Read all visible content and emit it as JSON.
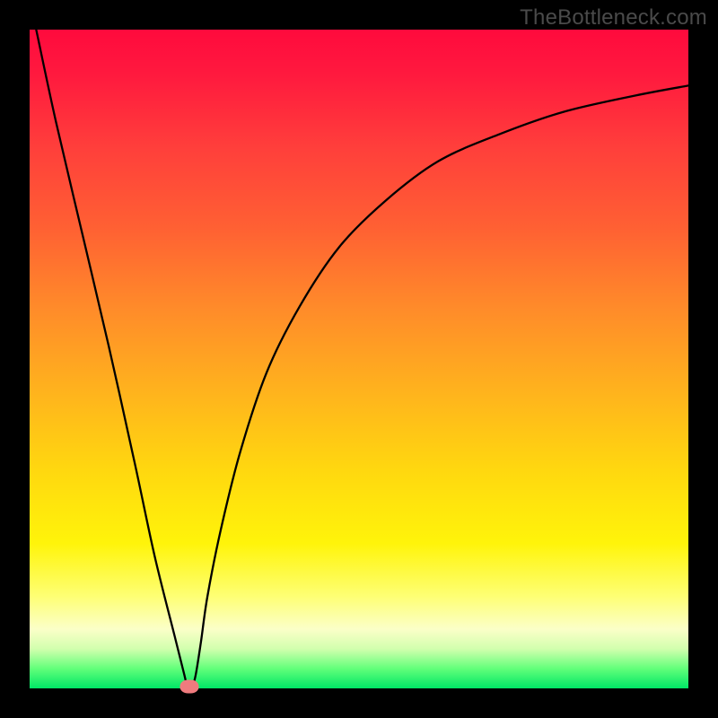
{
  "watermark": "TheBottleneck.com",
  "chart_data": {
    "type": "line",
    "title": "",
    "xlabel": "",
    "ylabel": "",
    "xlim": [
      0,
      100
    ],
    "ylim": [
      0,
      100
    ],
    "grid": false,
    "legend": false,
    "background_gradient": {
      "top_color": "#ff0a3d",
      "bottom_color": "#00e766",
      "description": "vertical gradient from red (high bottleneck) through orange/yellow to green (no bottleneck)"
    },
    "series": [
      {
        "name": "bottleneck-curve",
        "color": "#000000",
        "x": [
          1,
          4,
          8,
          12,
          16,
          19,
          22,
          23.5,
          24,
          24.6,
          25.2,
          26,
          27,
          29,
          32,
          36,
          41,
          47,
          54,
          62,
          71,
          81,
          92,
          100
        ],
        "y": [
          100,
          86,
          69,
          52,
          34,
          20,
          8,
          2,
          0,
          0,
          2,
          7,
          14,
          24,
          36,
          48,
          58,
          67,
          74,
          80,
          84,
          87.5,
          90,
          91.5
        ]
      }
    ],
    "markers": [
      {
        "name": "optimal-point",
        "x": 24.3,
        "y": 0.3,
        "color": "#ef7b7e"
      }
    ]
  }
}
